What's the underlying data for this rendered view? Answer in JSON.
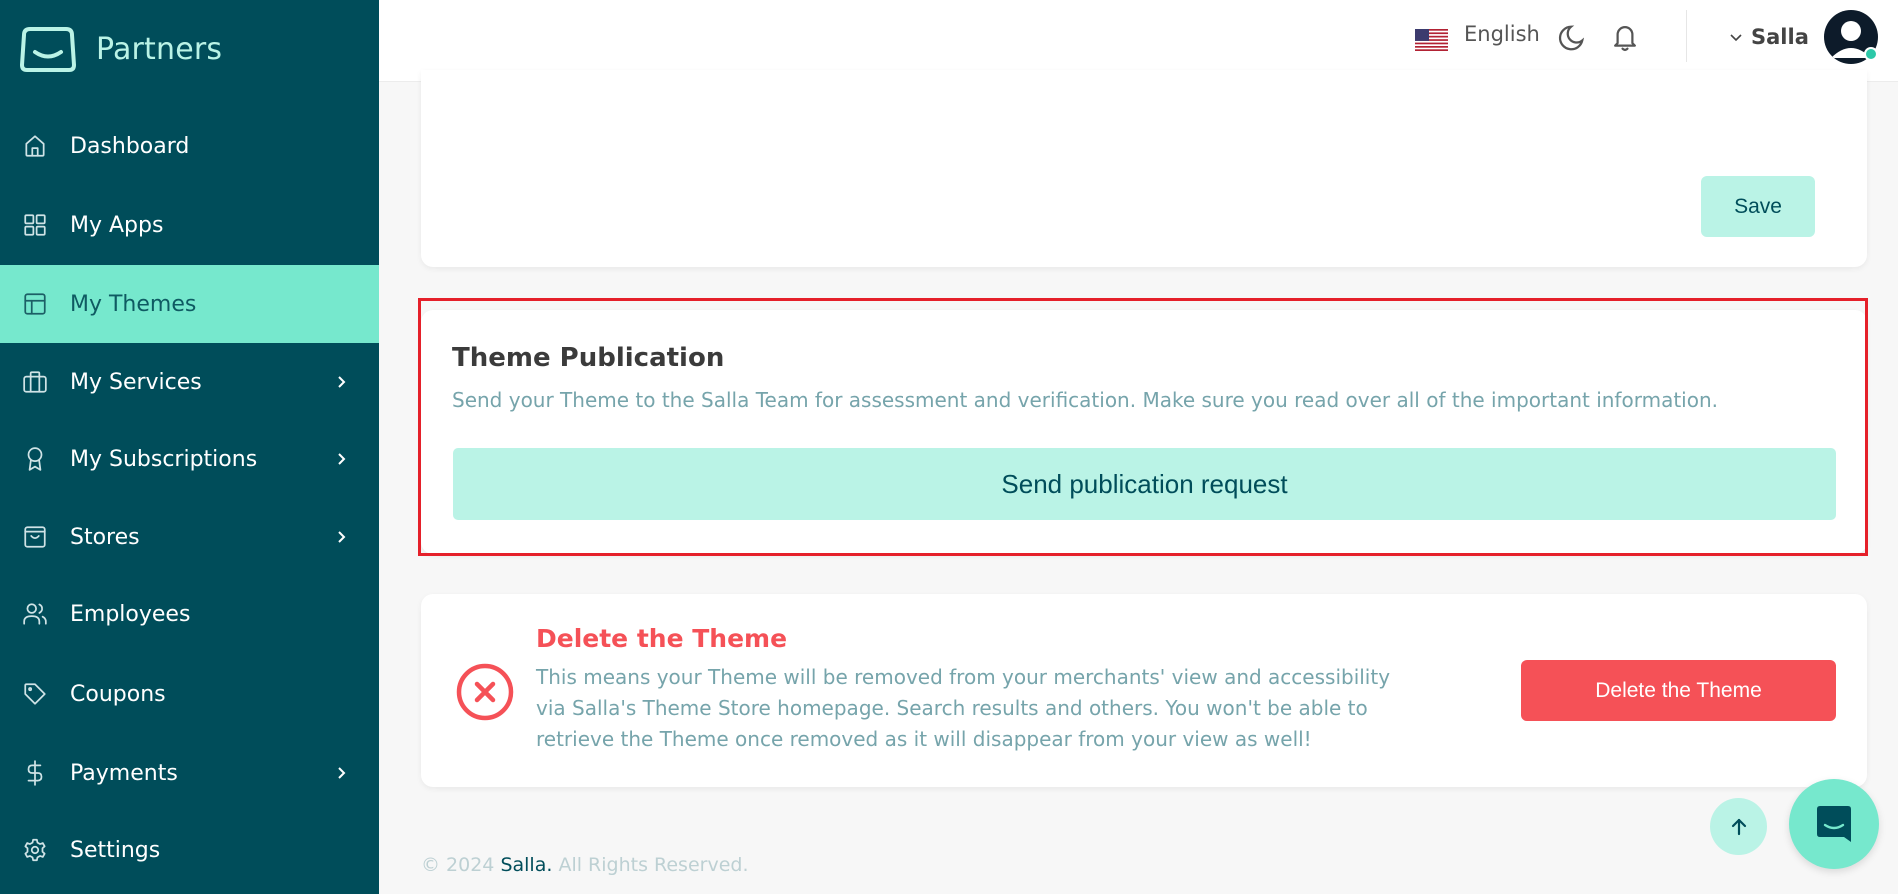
{
  "brand": {
    "name": "Partners"
  },
  "sidebar": {
    "items": [
      {
        "label": "Dashboard",
        "icon": "home-icon",
        "has_submenu": false,
        "active": false
      },
      {
        "label": "My Apps",
        "icon": "grid-icon",
        "has_submenu": false,
        "active": false
      },
      {
        "label": "My Themes",
        "icon": "layout-icon",
        "has_submenu": false,
        "active": true
      },
      {
        "label": "My Services",
        "icon": "briefcase-icon",
        "has_submenu": true,
        "active": false
      },
      {
        "label": "My Subscriptions",
        "icon": "award-icon",
        "has_submenu": true,
        "active": false
      },
      {
        "label": "Stores",
        "icon": "shopping-bag-icon",
        "has_submenu": true,
        "active": false
      },
      {
        "label": "Employees",
        "icon": "users-icon",
        "has_submenu": false,
        "active": false
      },
      {
        "label": "Coupons",
        "icon": "tag-icon",
        "has_submenu": false,
        "active": false
      },
      {
        "label": "Payments",
        "icon": "dollar-icon",
        "has_submenu": true,
        "active": false
      },
      {
        "label": "Settings",
        "icon": "gear-icon",
        "has_submenu": false,
        "active": false
      }
    ]
  },
  "header": {
    "language": "English",
    "user_name": "Salla",
    "status_color": "#2cc8a8"
  },
  "settings_card": {
    "save_label": "Save"
  },
  "publication": {
    "title": "Theme Publication",
    "description": "Send your Theme to the Salla Team for assessment and verification. Make sure you read over all of the important information.",
    "button_label": "Send publication request"
  },
  "delete": {
    "title": "Delete the Theme",
    "description": "This means your Theme will be removed from your merchants' view and accessibility via Salla's Theme Store homepage. Search results and others. You won't be able to retrieve the Theme once removed as it will disappear from your view as well!",
    "button_label": "Delete the Theme"
  },
  "footer": {
    "prefix": "© 2024",
    "brand": "Salla.",
    "suffix": "All Rights Reserved."
  },
  "colors": {
    "sidebar_bg": "#004d5a",
    "active_bg": "#76e8cd",
    "accent_light": "#baf3e6",
    "danger": "#f55157",
    "highlight_outline": "#e5202a"
  }
}
